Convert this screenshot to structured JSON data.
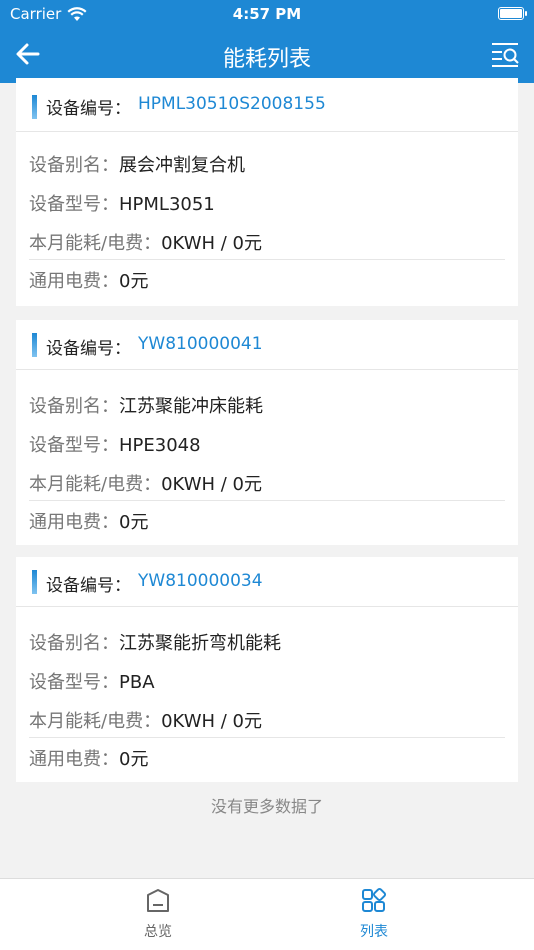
{
  "status": {
    "carrier": "Carrier",
    "time": "4:57 PM"
  },
  "nav": {
    "title": "能耗列表",
    "back_icon": "arrow-left-icon",
    "filter_icon": "list-search-icon"
  },
  "labels": {
    "device_no": "设备编号：",
    "alias": "设备别名：",
    "model": "设备型号：",
    "energy": "本月能耗/电费：",
    "general_fee": "通用电费："
  },
  "devices": [
    {
      "no": "HPML30510S2008155",
      "alias": "展会冲割复合机",
      "model": "HPML3051",
      "energy": "0KWH / 0元",
      "general_fee": "0元"
    },
    {
      "no": "YW810000041",
      "alias": "江苏聚能冲床能耗",
      "model": "HPE3048",
      "energy": "0KWH / 0元",
      "general_fee": "0元"
    },
    {
      "no": "YW810000034",
      "alias": "江苏聚能折弯机能耗",
      "model": "PBA",
      "energy": "0KWH / 0元",
      "general_fee": "0元"
    }
  ],
  "footer_text": "没有更多数据了",
  "tabs": [
    {
      "label": "总览",
      "icon": "home-icon",
      "active": false
    },
    {
      "label": "列表",
      "icon": "grid-icon",
      "active": true
    }
  ],
  "colors": {
    "primary": "#1e88d4",
    "inactive": "#666666"
  }
}
